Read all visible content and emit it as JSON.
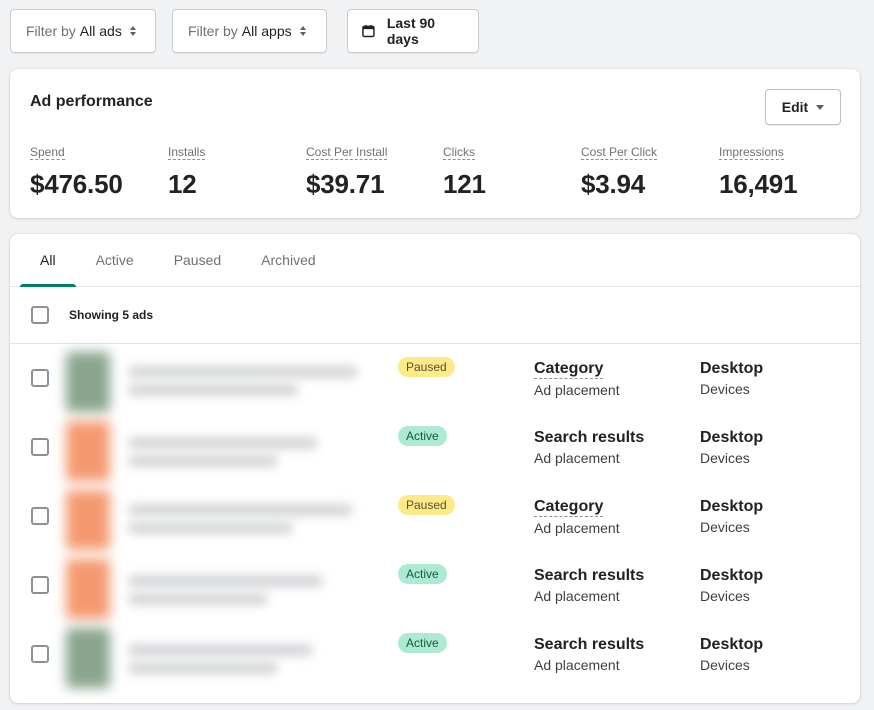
{
  "filters": {
    "ads": {
      "prefix": "Filter by",
      "value": "All ads"
    },
    "apps": {
      "prefix": "Filter by",
      "value": "All apps"
    },
    "date": {
      "label": "Last 90 days"
    }
  },
  "performance": {
    "title": "Ad performance",
    "edit_label": "Edit",
    "metrics": [
      {
        "label": "Spend",
        "value": "$476.50"
      },
      {
        "label": "Installs",
        "value": "12"
      },
      {
        "label": "Cost Per Install",
        "value": "$39.71"
      },
      {
        "label": "Clicks",
        "value": "121"
      },
      {
        "label": "Cost Per Click",
        "value": "$3.94"
      },
      {
        "label": "Impressions",
        "value": "16,491"
      }
    ]
  },
  "list": {
    "tabs": [
      {
        "label": "All",
        "active": true
      },
      {
        "label": "Active"
      },
      {
        "label": "Paused"
      },
      {
        "label": "Archived"
      }
    ],
    "showing": "Showing 5 ads",
    "rows": [
      {
        "status": "Paused",
        "placement": "Category",
        "placement_sub": "Ad placement",
        "device": "Desktop",
        "device_sub": "Devices"
      },
      {
        "status": "Active",
        "placement": "Search results",
        "placement_sub": "Ad placement",
        "device": "Desktop",
        "device_sub": "Devices"
      },
      {
        "status": "Paused",
        "placement": "Category",
        "placement_sub": "Ad placement",
        "device": "Desktop",
        "device_sub": "Devices"
      },
      {
        "status": "Active",
        "placement": "Search results",
        "placement_sub": "Ad placement",
        "device": "Desktop",
        "device_sub": "Devices"
      },
      {
        "status": "Active",
        "placement": "Search results",
        "placement_sub": "Ad placement",
        "device": "Desktop",
        "device_sub": "Devices"
      }
    ]
  },
  "colors": {
    "accent": "#008060",
    "paused_badge": "#ffea8a",
    "active_badge": "#aee9d1"
  }
}
